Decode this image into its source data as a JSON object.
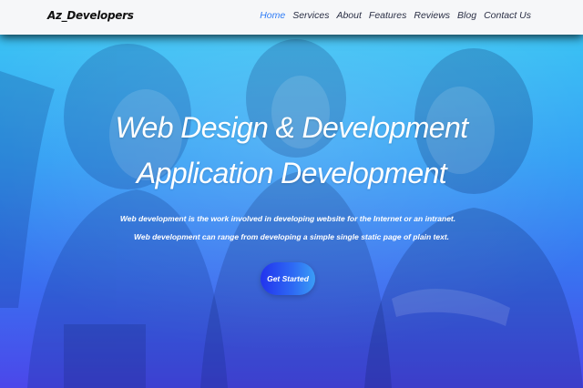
{
  "navbar": {
    "brand": "Az_Developers",
    "links": [
      "Home",
      "Services",
      "About",
      "Features",
      "Reviews",
      "Blog",
      "Contact Us"
    ],
    "active": "Home"
  },
  "hero": {
    "title_line_1": "Web Design & Development",
    "title_line_2": "Application Development",
    "description_1": "Web development is the work involved in developing website for the Internet or an intranet.",
    "description_2": "Web development can range from developing a simple single static page of plain text.",
    "cta_label": "Get Started"
  },
  "colors": {
    "gradient_top": "#39c2f4",
    "gradient_bottom": "#4b47ea",
    "active_link": "#2f7cf6",
    "navbar_bg": "#f6f7f9"
  }
}
